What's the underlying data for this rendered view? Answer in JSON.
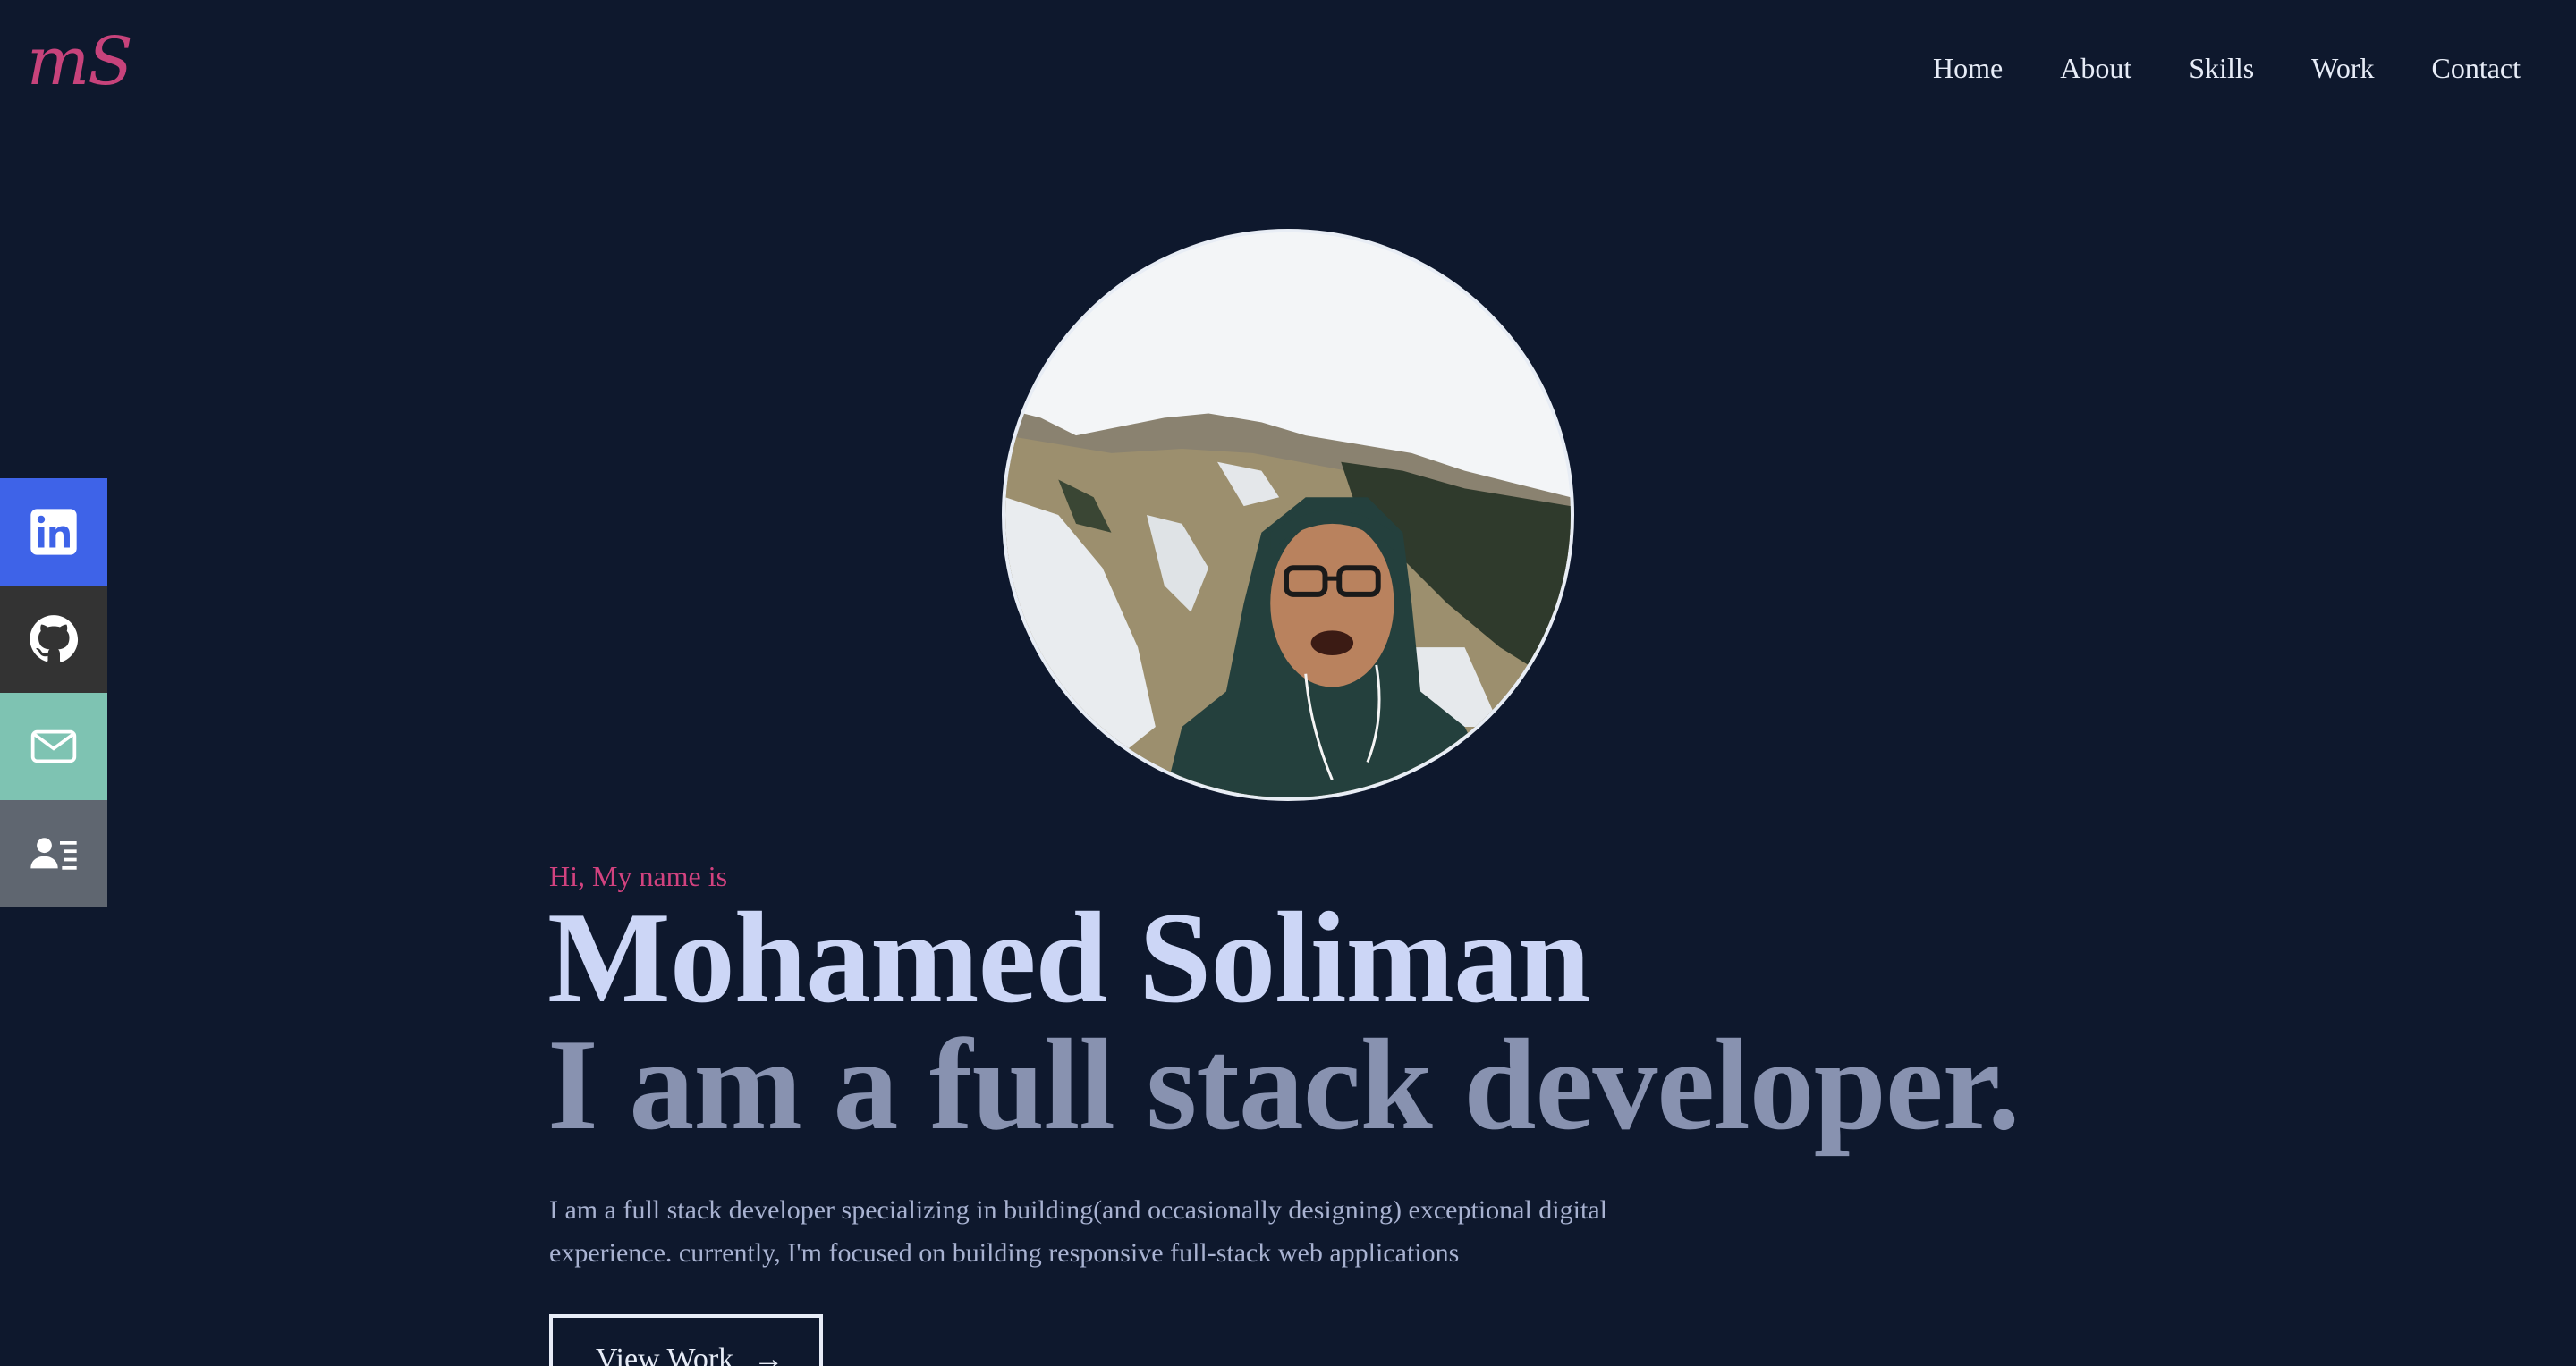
{
  "header": {
    "logo": "mS",
    "nav": [
      "Home",
      "About",
      "Skills",
      "Work",
      "Contact"
    ]
  },
  "social": [
    {
      "icon": "linkedin-icon",
      "color": "#3e63e8"
    },
    {
      "icon": "github-icon",
      "color": "#333333"
    },
    {
      "icon": "mail-icon",
      "color": "#7ec3b2"
    },
    {
      "icon": "resume-icon",
      "color": "#5f6670"
    }
  ],
  "hero": {
    "greeting": "Hi, My name is",
    "name": "Mohamed Soliman",
    "tagline": "I am a full stack developer.",
    "description": "I am a full stack developer specializing in building(and occasionally designing) exceptional digital experience. currently, I'm focused on building responsive full-stack web applications",
    "cta_label": "View Work",
    "cta_arrow": "→"
  },
  "colors": {
    "background": "#0e182d",
    "accent": "#d2427f",
    "name": "#ccd6f6",
    "tagline": "#8892b0"
  }
}
